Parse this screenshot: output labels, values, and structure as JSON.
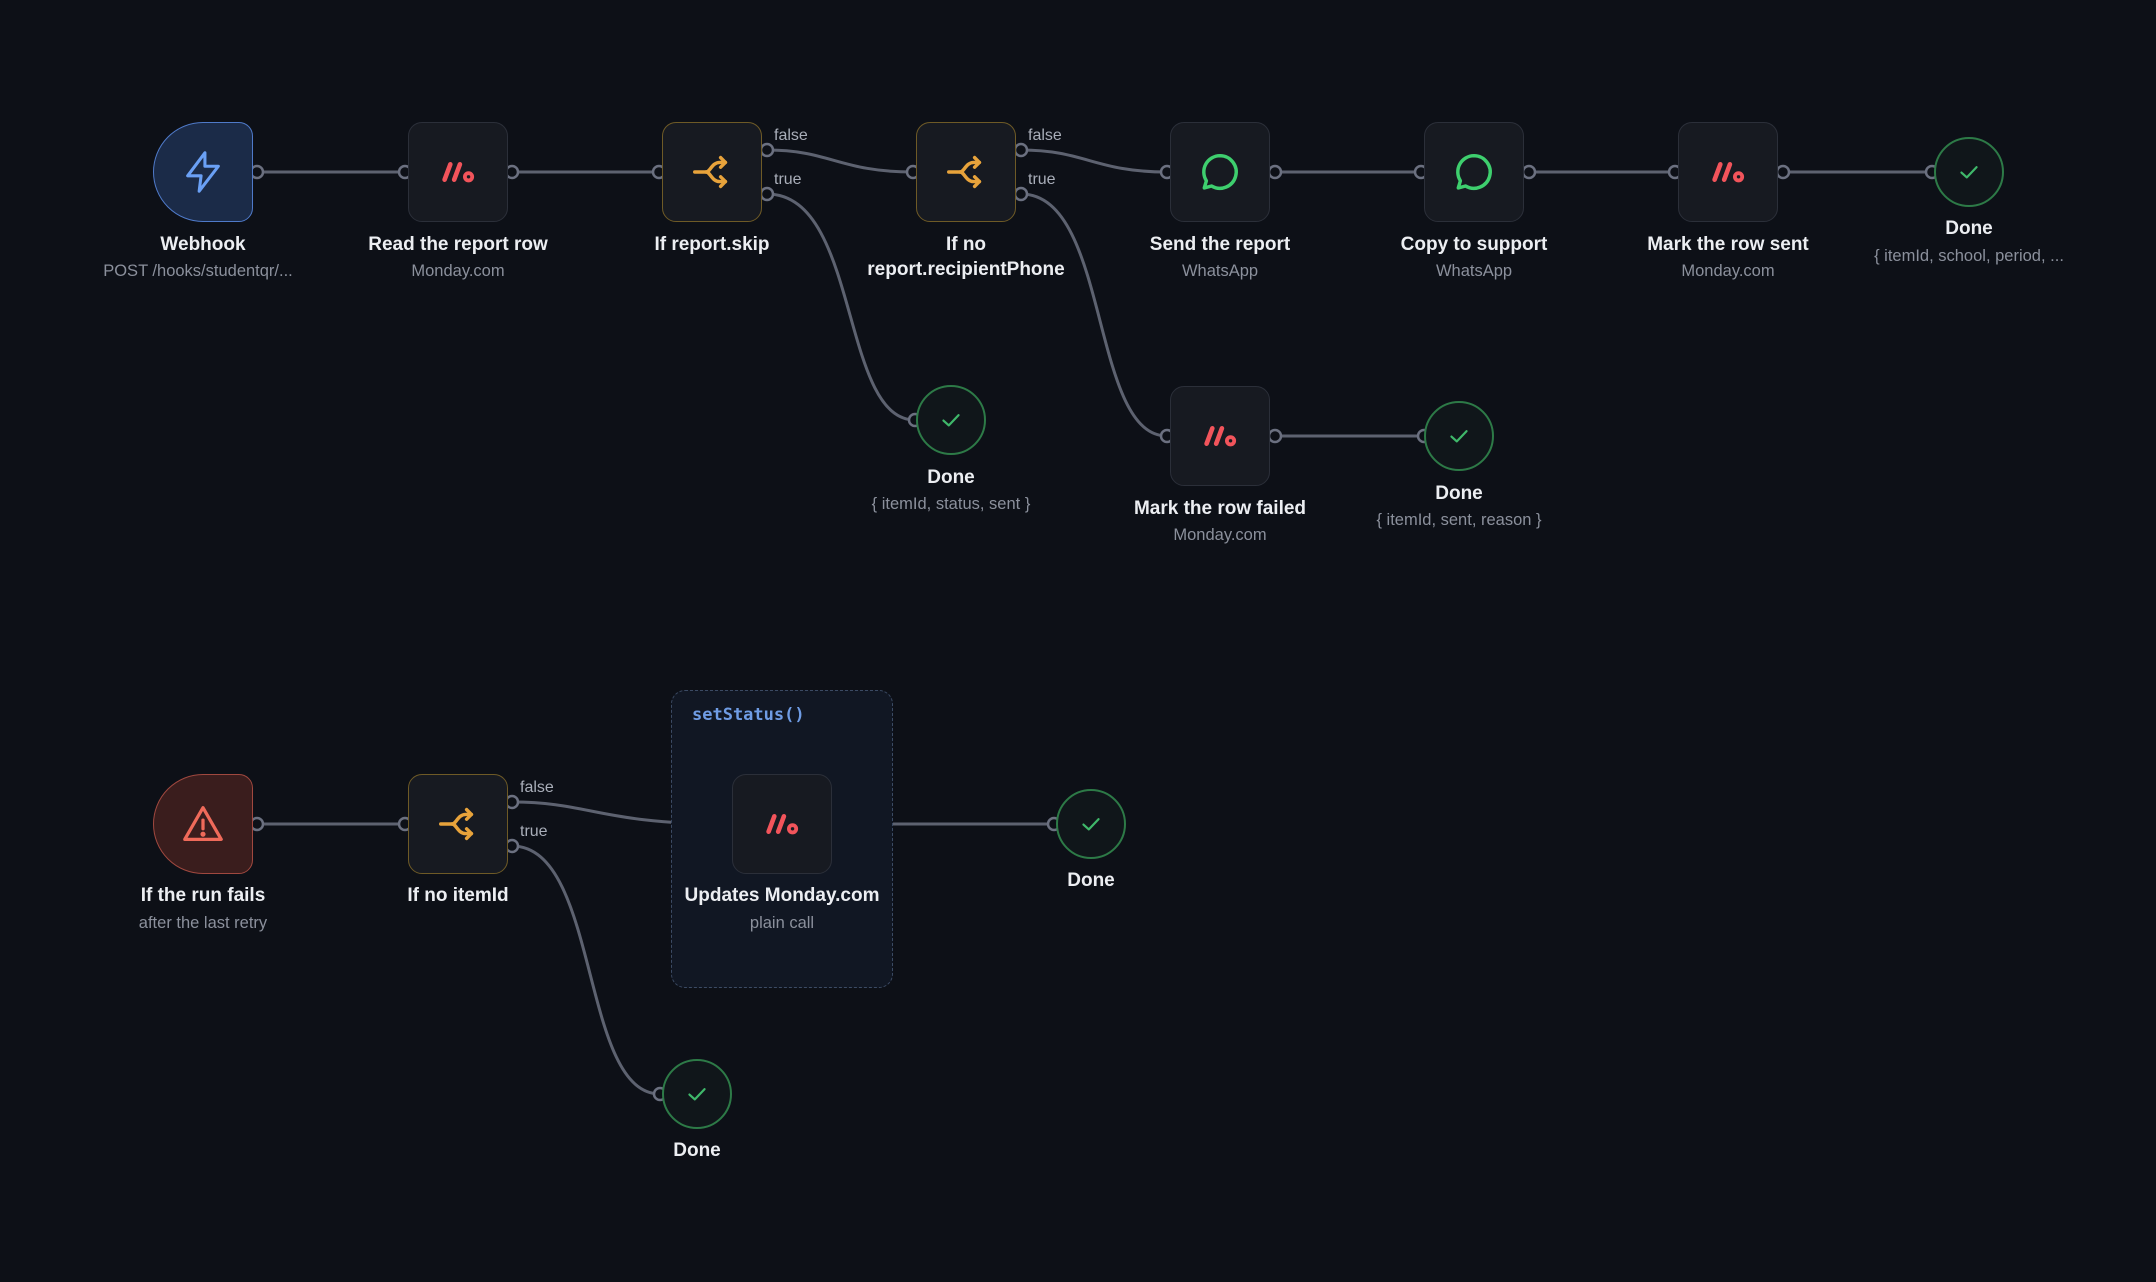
{
  "colors": {
    "background": "#0d1017",
    "edge": "#5d6270",
    "accent_blue": "#6aa0f5",
    "monday_red": "#f2545b",
    "branch_orange": "#e8a33b",
    "whatsapp_green": "#3ecf6e",
    "done_green": "#3fb86a",
    "error_red": "#ef6a5a"
  },
  "main_flow": {
    "webhook": {
      "icon": "bolt-icon",
      "title": "Webhook",
      "subtitle": "POST /hooks/studentqr/..."
    },
    "read_row": {
      "icon": "monday-icon",
      "title": "Read the report row",
      "subtitle": "Monday.com"
    },
    "if_skip": {
      "icon": "branch-icon",
      "title": "If report.skip",
      "false_label": "false",
      "true_label": "true"
    },
    "if_phone": {
      "icon": "branch-icon",
      "title_line1": "If no",
      "title_line2": "report.recipientPhone",
      "false_label": "false",
      "true_label": "true"
    },
    "send_report": {
      "icon": "whatsapp-icon",
      "title": "Send the report",
      "subtitle": "WhatsApp"
    },
    "copy_support": {
      "icon": "whatsapp-icon",
      "title": "Copy to support",
      "subtitle": "WhatsApp"
    },
    "mark_sent": {
      "icon": "monday-icon",
      "title": "Mark the row sent",
      "subtitle": "Monday.com"
    },
    "done_main": {
      "icon": "check-icon",
      "title": "Done",
      "subtitle": "{ itemId, school, period, ..."
    },
    "done_skip": {
      "icon": "check-icon",
      "title": "Done",
      "subtitle": "{ itemId, status, sent }"
    },
    "mark_failed": {
      "icon": "monday-icon",
      "title": "Mark the row failed",
      "subtitle": "Monday.com"
    },
    "done_failed": {
      "icon": "check-icon",
      "title": "Done",
      "subtitle": "{ itemId, sent, reason }"
    }
  },
  "error_flow": {
    "on_fail": {
      "icon": "warning-icon",
      "title": "If the run fails",
      "subtitle": "after the last retry"
    },
    "if_item": {
      "icon": "branch-icon",
      "title": "If no itemId",
      "false_label": "false",
      "true_label": "true"
    },
    "group": {
      "label": "setStatus()"
    },
    "update": {
      "icon": "monday-icon",
      "title": "Updates Monday.com",
      "subtitle": "plain call"
    },
    "done_update": {
      "icon": "check-icon",
      "title": "Done"
    },
    "done_noitem": {
      "icon": "check-icon",
      "title": "Done"
    }
  }
}
